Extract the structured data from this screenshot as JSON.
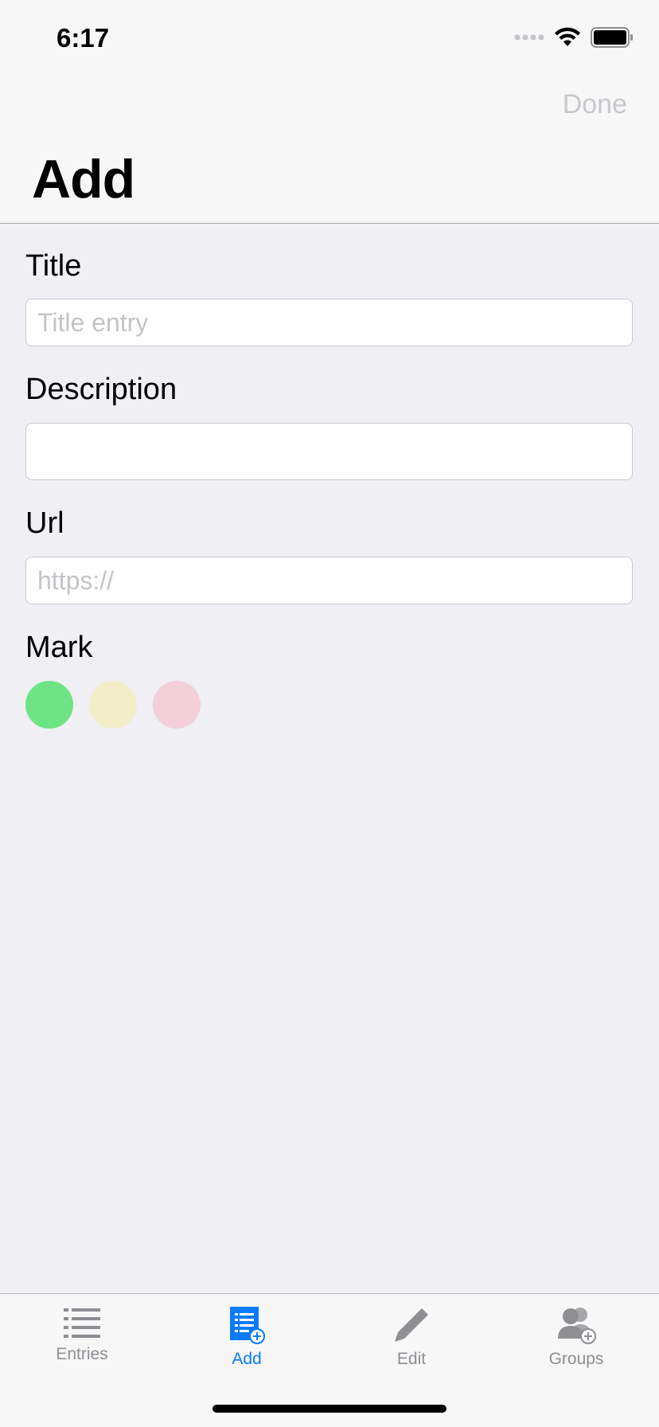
{
  "status_bar": {
    "time": "6:17"
  },
  "nav": {
    "done_label": "Done",
    "title": "Add"
  },
  "form": {
    "title_label": "Title",
    "title_placeholder": "Title entry",
    "title_value": "",
    "description_label": "Description",
    "description_value": "",
    "url_label": "Url",
    "url_placeholder": "https://",
    "url_value": "",
    "mark_label": "Mark",
    "mark_colors": [
      "#6ee383",
      "#f2eec8",
      "#f2cfd9"
    ]
  },
  "tabs": [
    {
      "label": "Entries",
      "icon": "list-icon",
      "active": false
    },
    {
      "label": "Add",
      "icon": "add-entry-icon",
      "active": true
    },
    {
      "label": "Edit",
      "icon": "pencil-icon",
      "active": false
    },
    {
      "label": "Groups",
      "icon": "add-group-icon",
      "active": false
    }
  ],
  "colors": {
    "accent": "#0a7aff",
    "inactive": "#8e8e93",
    "background": "#efeff4"
  }
}
